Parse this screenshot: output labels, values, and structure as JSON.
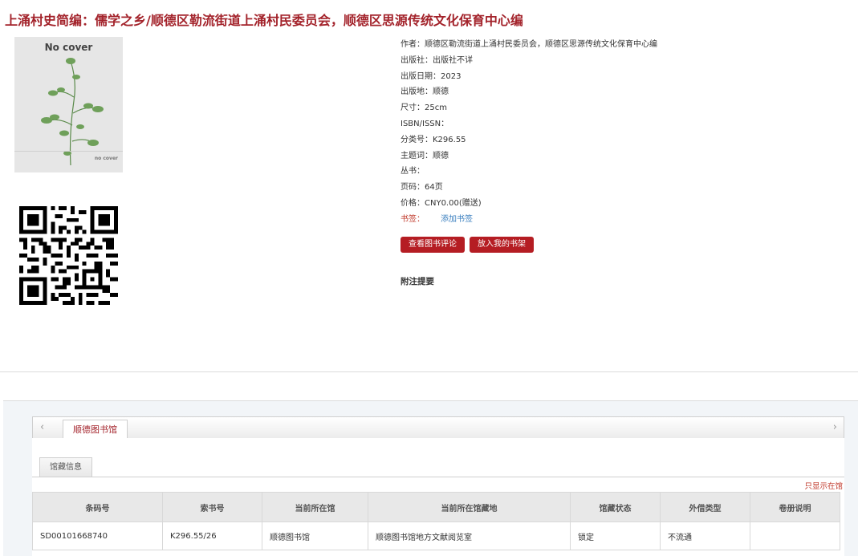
{
  "book": {
    "title": "上涌村史简编：儒学之乡/顺德区勒流街道上涌村民委员会，顺德区思源传统文化保育中心编",
    "cover_text_top": "No cover",
    "cover_text_bottom": "no cover"
  },
  "meta": {
    "author": "作者：顺德区勒流街道上涌村民委员会，顺德区思源传统文化保育中心编",
    "publisher": "出版社：出版社不详",
    "pub_date": "出版日期：2023",
    "pub_place": "出版地：顺德",
    "size": "尺寸：25cm",
    "isbn": "ISBN/ISSN：",
    "class_no": "分类号：K296.55",
    "subject": "主题词：顺德",
    "series": "丛书：",
    "pages": "页码：64页",
    "price": "价格：CNY0.00(赠送)",
    "tag_label": "书签：",
    "tag_link": "添加书签"
  },
  "actions": {
    "view_reviews": "查看图书评论",
    "add_shelf": "放入我的书架"
  },
  "notes_heading": "附注提要",
  "holdings": {
    "library_tab": "顺德图书馆",
    "info_tab": "馆藏信息",
    "only_show": "只显示在馆",
    "columns": [
      "条码号",
      "索书号",
      "当前所在馆",
      "当前所在馆藏地",
      "馆藏状态",
      "外借类型",
      "卷册说明"
    ],
    "rows": [
      [
        "SD00101668740",
        "K296.55/26",
        "顺德图书馆",
        "顺德图书馆地方文献阅览室",
        "锁定",
        "不流通",
        ""
      ]
    ]
  },
  "colors": {
    "accent": "#a3232b",
    "button": "#b51d23",
    "link": "#3a7fbf"
  }
}
